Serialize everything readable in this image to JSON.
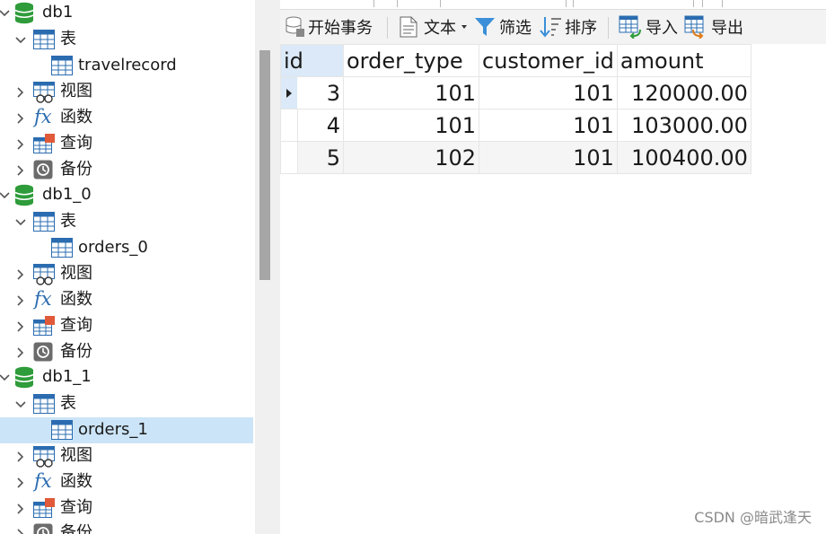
{
  "navigator": {
    "databases": [
      {
        "name": "db1",
        "tables_label": "表",
        "tables": [
          "travelrecord"
        ],
        "views_label": "视图",
        "functions_label": "函数",
        "queries_label": "查询",
        "backups_label": "备份"
      },
      {
        "name": "db1_0",
        "tables_label": "表",
        "tables": [
          "orders_0"
        ],
        "views_label": "视图",
        "functions_label": "函数",
        "queries_label": "查询",
        "backups_label": "备份"
      },
      {
        "name": "db1_1",
        "tables_label": "表",
        "tables": [
          "orders_1"
        ],
        "views_label": "视图",
        "functions_label": "函数",
        "queries_label": "查询",
        "backups_label": "备份"
      }
    ],
    "selected_table": "orders_1"
  },
  "toolbar": {
    "begin_transaction": "开始事务",
    "text": "文本",
    "filter": "筛选",
    "sort": "排序",
    "import": "导入",
    "export": "导出"
  },
  "grid": {
    "columns": [
      "id",
      "order_type",
      "customer_id",
      "amount"
    ],
    "selected_column": "id",
    "rows": [
      [
        "3",
        "101",
        "101",
        "120000.00"
      ],
      [
        "4",
        "101",
        "101",
        "103000.00"
      ],
      [
        "5",
        "102",
        "101",
        "100400.00"
      ]
    ],
    "current_row": 0
  },
  "watermark": "CSDN @暗武逢天",
  "colors": {
    "db_icon": "#2e9c3a",
    "table_icon": "#2b6cb0",
    "selection": "#cce4f7"
  },
  "icons": {
    "database": "database-icon",
    "table_group": "table-icon",
    "view": "view-icon",
    "function": "function-icon",
    "query": "query-icon",
    "backup": "backup-icon"
  }
}
